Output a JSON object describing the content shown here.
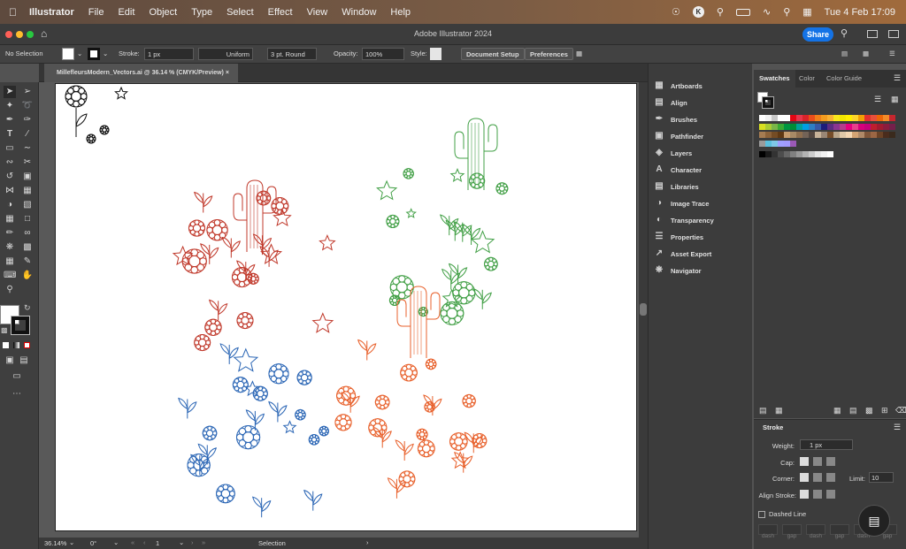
{
  "menubar": {
    "app": "Illustrator",
    "items": [
      "File",
      "Edit",
      "Object",
      "Type",
      "Select",
      "Effect",
      "View",
      "Window",
      "Help"
    ],
    "user_initial": "K",
    "datetime": "Tue 4 Feb  17:09"
  },
  "window": {
    "title": "Adobe Illustrator 2024",
    "share": "Share"
  },
  "control": {
    "selection": "No Selection",
    "stroke_label": "Stroke:",
    "stroke_weight": "1 px",
    "profile": "Uniform",
    "brush": "3 pt. Round",
    "opacity_label": "Opacity:",
    "opacity": "100%",
    "style_label": "Style:",
    "doc_setup": "Document Setup",
    "preferences": "Preferences"
  },
  "document": {
    "tab": "MillefleursModern_Vectors.ai @ 36.14 % (CMYK/Preview)"
  },
  "status": {
    "zoom": "36.14%",
    "rotation": "0°",
    "artboard": "1",
    "tool": "Selection"
  },
  "panels": [
    "Artboards",
    "Align",
    "Brushes",
    "Pathfinder",
    "Layers",
    "Character",
    "Libraries",
    "Image Trace",
    "Transparency",
    "Properties",
    "Asset Export",
    "Navigator"
  ],
  "swatches": {
    "tabs": [
      "Swatches",
      "Color",
      "Color Guide"
    ],
    "row1": [
      "#ffffff",
      "#f2f2f2",
      "#c8c8c8",
      "#ffffff",
      "#ffffff",
      "#e30613",
      "#e5374d",
      "#d8232a",
      "#e94e1b",
      "#f07f1a",
      "#f39c1f",
      "#f9b233",
      "#f8e71c",
      "#f2e500",
      "#ffed00",
      "#fdd52b",
      "#f29f05",
      "#e3312e",
      "#e94f3a",
      "#ec6608",
      "#f38b28",
      "#c6262e"
    ],
    "row2": [
      "#d9e021",
      "#aacc33",
      "#7ab648",
      "#3aaa35",
      "#009640",
      "#008d36",
      "#00a19a",
      "#009fe3",
      "#2d7ec4",
      "#3658a7",
      "#1d1d7b",
      "#5b2c82",
      "#8b3491",
      "#b43c8c",
      "#e6007e",
      "#e83e8c",
      "#d6007b",
      "#c4007a",
      "#be1e2d",
      "#a31a30",
      "#8b1c3e",
      "#751f4b"
    ],
    "row3": [
      "#a67c52",
      "#8c6239",
      "#754c24",
      "#603913",
      "#c69c6d",
      "#a88a66",
      "#8d6e4f",
      "#736357",
      "#534741",
      "#c7b299",
      "#998675",
      "#754c29",
      "#b9a58a",
      "#e0c8a8",
      "#f5d7b3",
      "#d4a373",
      "#b08968",
      "#7f5539",
      "#9c6644",
      "#6b4226",
      "#4a2c1d",
      "#3a2a1d"
    ],
    "row4": [
      "#9b9b9b",
      "#5bc0de",
      "#7fc8e8",
      "#a0a0ff",
      "#a29bfe",
      "#9b59b6"
    ],
    "row5": [
      "#000000",
      "#1a1a1a",
      "#333333",
      "#4d4d4d",
      "#666666",
      "#808080",
      "#999999",
      "#b3b3b3",
      "#cccccc",
      "#e6e6e6",
      "#f2f2f2",
      "#ffffff"
    ]
  },
  "stroke_panel": {
    "title": "Stroke",
    "weight_label": "Weight:",
    "weight": "1 px",
    "cap_label": "Cap:",
    "corner_label": "Corner:",
    "limit_label": "Limit:",
    "limit": "10",
    "align_label": "Align Stroke:",
    "dashed": "Dashed Line",
    "dash": "dash",
    "gap": "gap"
  },
  "artwork_colors": {
    "red": "#c0392b",
    "green": "#43a047",
    "blue": "#2b66b5",
    "orange": "#e8612c",
    "black": "#111111"
  }
}
